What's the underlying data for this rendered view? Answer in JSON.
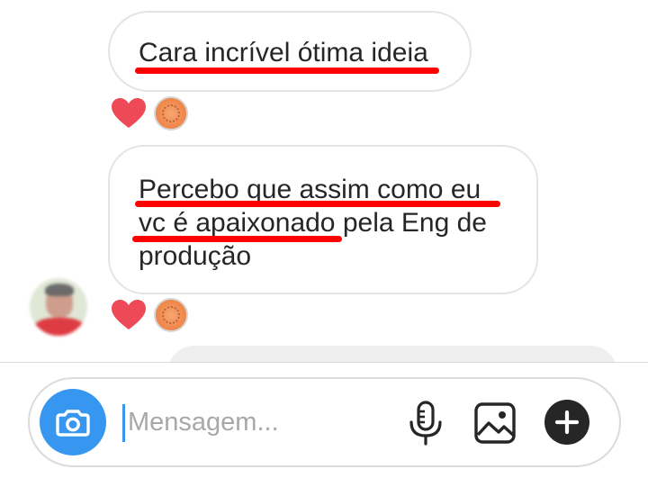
{
  "messages": [
    {
      "lines": [
        "Cara incrível ótima ideia"
      ],
      "reaction": {
        "emoji": "heart",
        "color": "#ed4956"
      }
    },
    {
      "lines": [
        "Percebo que assim como eu",
        "vc é apaixonado pela Eng de",
        "produção"
      ],
      "reaction": {
        "emoji": "heart",
        "color": "#ed4956"
      }
    }
  ],
  "annotation_color": "#ff0000",
  "composer": {
    "placeholder": "Mensagem...",
    "value": "",
    "icons": [
      "camera-icon",
      "microphone-icon",
      "image-icon",
      "plus-icon"
    ],
    "camera_color": "#3797f0"
  }
}
